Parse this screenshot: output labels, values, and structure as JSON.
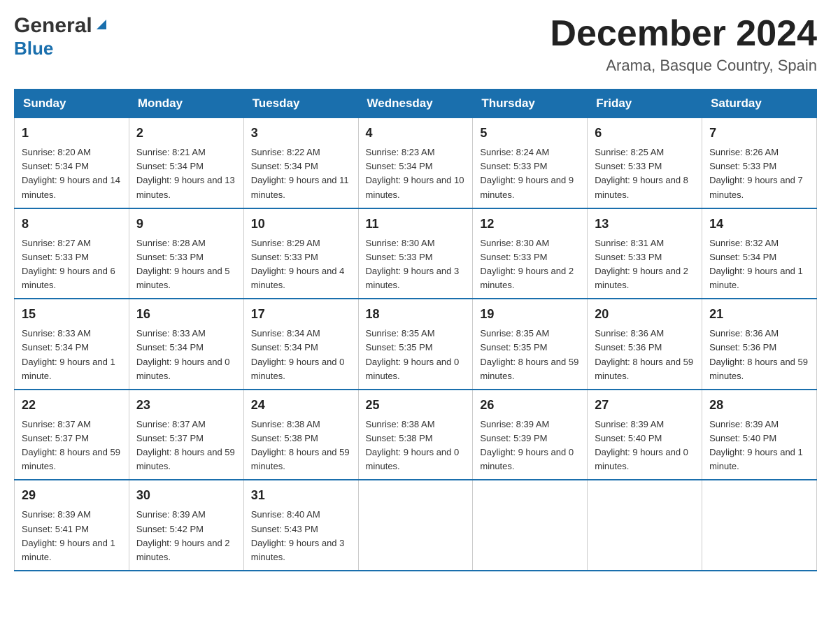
{
  "header": {
    "logo_general": "General",
    "logo_blue": "Blue",
    "month_title": "December 2024",
    "location": "Arama, Basque Country, Spain"
  },
  "days_of_week": [
    "Sunday",
    "Monday",
    "Tuesday",
    "Wednesday",
    "Thursday",
    "Friday",
    "Saturday"
  ],
  "weeks": [
    [
      {
        "day": "1",
        "sunrise": "8:20 AM",
        "sunset": "5:34 PM",
        "daylight": "9 hours and 14 minutes."
      },
      {
        "day": "2",
        "sunrise": "8:21 AM",
        "sunset": "5:34 PM",
        "daylight": "9 hours and 13 minutes."
      },
      {
        "day": "3",
        "sunrise": "8:22 AM",
        "sunset": "5:34 PM",
        "daylight": "9 hours and 11 minutes."
      },
      {
        "day": "4",
        "sunrise": "8:23 AM",
        "sunset": "5:34 PM",
        "daylight": "9 hours and 10 minutes."
      },
      {
        "day": "5",
        "sunrise": "8:24 AM",
        "sunset": "5:33 PM",
        "daylight": "9 hours and 9 minutes."
      },
      {
        "day": "6",
        "sunrise": "8:25 AM",
        "sunset": "5:33 PM",
        "daylight": "9 hours and 8 minutes."
      },
      {
        "day": "7",
        "sunrise": "8:26 AM",
        "sunset": "5:33 PM",
        "daylight": "9 hours and 7 minutes."
      }
    ],
    [
      {
        "day": "8",
        "sunrise": "8:27 AM",
        "sunset": "5:33 PM",
        "daylight": "9 hours and 6 minutes."
      },
      {
        "day": "9",
        "sunrise": "8:28 AM",
        "sunset": "5:33 PM",
        "daylight": "9 hours and 5 minutes."
      },
      {
        "day": "10",
        "sunrise": "8:29 AM",
        "sunset": "5:33 PM",
        "daylight": "9 hours and 4 minutes."
      },
      {
        "day": "11",
        "sunrise": "8:30 AM",
        "sunset": "5:33 PM",
        "daylight": "9 hours and 3 minutes."
      },
      {
        "day": "12",
        "sunrise": "8:30 AM",
        "sunset": "5:33 PM",
        "daylight": "9 hours and 2 minutes."
      },
      {
        "day": "13",
        "sunrise": "8:31 AM",
        "sunset": "5:33 PM",
        "daylight": "9 hours and 2 minutes."
      },
      {
        "day": "14",
        "sunrise": "8:32 AM",
        "sunset": "5:34 PM",
        "daylight": "9 hours and 1 minute."
      }
    ],
    [
      {
        "day": "15",
        "sunrise": "8:33 AM",
        "sunset": "5:34 PM",
        "daylight": "9 hours and 1 minute."
      },
      {
        "day": "16",
        "sunrise": "8:33 AM",
        "sunset": "5:34 PM",
        "daylight": "9 hours and 0 minutes."
      },
      {
        "day": "17",
        "sunrise": "8:34 AM",
        "sunset": "5:34 PM",
        "daylight": "9 hours and 0 minutes."
      },
      {
        "day": "18",
        "sunrise": "8:35 AM",
        "sunset": "5:35 PM",
        "daylight": "9 hours and 0 minutes."
      },
      {
        "day": "19",
        "sunrise": "8:35 AM",
        "sunset": "5:35 PM",
        "daylight": "8 hours and 59 minutes."
      },
      {
        "day": "20",
        "sunrise": "8:36 AM",
        "sunset": "5:36 PM",
        "daylight": "8 hours and 59 minutes."
      },
      {
        "day": "21",
        "sunrise": "8:36 AM",
        "sunset": "5:36 PM",
        "daylight": "8 hours and 59 minutes."
      }
    ],
    [
      {
        "day": "22",
        "sunrise": "8:37 AM",
        "sunset": "5:37 PM",
        "daylight": "8 hours and 59 minutes."
      },
      {
        "day": "23",
        "sunrise": "8:37 AM",
        "sunset": "5:37 PM",
        "daylight": "8 hours and 59 minutes."
      },
      {
        "day": "24",
        "sunrise": "8:38 AM",
        "sunset": "5:38 PM",
        "daylight": "8 hours and 59 minutes."
      },
      {
        "day": "25",
        "sunrise": "8:38 AM",
        "sunset": "5:38 PM",
        "daylight": "9 hours and 0 minutes."
      },
      {
        "day": "26",
        "sunrise": "8:39 AM",
        "sunset": "5:39 PM",
        "daylight": "9 hours and 0 minutes."
      },
      {
        "day": "27",
        "sunrise": "8:39 AM",
        "sunset": "5:40 PM",
        "daylight": "9 hours and 0 minutes."
      },
      {
        "day": "28",
        "sunrise": "8:39 AM",
        "sunset": "5:40 PM",
        "daylight": "9 hours and 1 minute."
      }
    ],
    [
      {
        "day": "29",
        "sunrise": "8:39 AM",
        "sunset": "5:41 PM",
        "daylight": "9 hours and 1 minute."
      },
      {
        "day": "30",
        "sunrise": "8:39 AM",
        "sunset": "5:42 PM",
        "daylight": "9 hours and 2 minutes."
      },
      {
        "day": "31",
        "sunrise": "8:40 AM",
        "sunset": "5:43 PM",
        "daylight": "9 hours and 3 minutes."
      },
      null,
      null,
      null,
      null
    ]
  ],
  "labels": {
    "sunrise": "Sunrise:",
    "sunset": "Sunset:",
    "daylight": "Daylight:"
  }
}
